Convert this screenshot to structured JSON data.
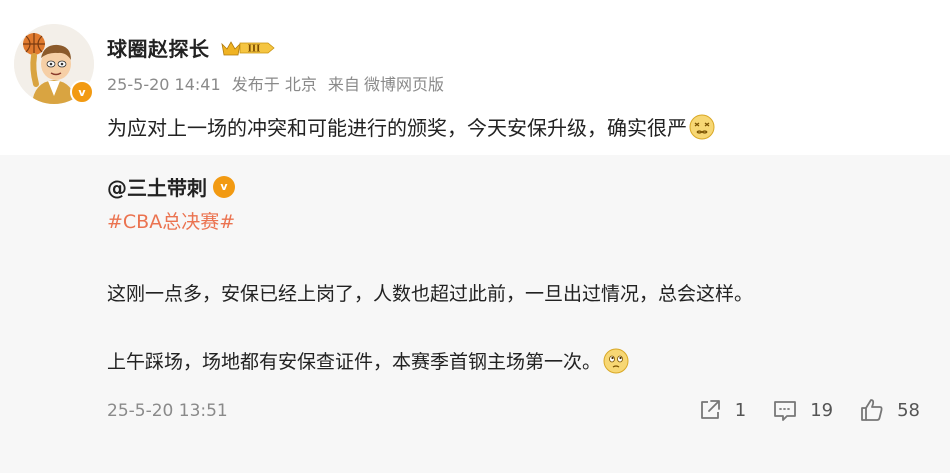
{
  "post": {
    "author": {
      "name": "球圈赵探长",
      "level_badge": "III",
      "verified_icon": "v-verified-icon",
      "verified_label": "v"
    },
    "meta": {
      "time": "25-5-20 14:41",
      "location": "发布于 北京",
      "source_prefix": "来自",
      "source": "微博网页版"
    },
    "text": "为应对上一场的冲突和可能进行的颁奖，今天安保升级，确实很严"
  },
  "repost": {
    "author": "@三土带刺",
    "hashtag": "#CBA总决赛#",
    "line1": "这刚一点多，安保已经上岗了，人数也超过此前，一旦出过情况，总会这样。",
    "line2": "上午踩场，场地都有安保查证件，本赛季首钢主场第一次。",
    "time": "25-5-20 13:51",
    "actions": {
      "share": {
        "icon": "share-icon",
        "count": "1"
      },
      "comment": {
        "icon": "comment-icon",
        "count": "19"
      },
      "like": {
        "icon": "thumbs-up-icon",
        "count": "58"
      }
    }
  },
  "colors": {
    "hashtag": "#eb7350",
    "verified": "#f29a12",
    "meta": "#8a8a8a",
    "repost_bg": "#f7f7f7"
  }
}
